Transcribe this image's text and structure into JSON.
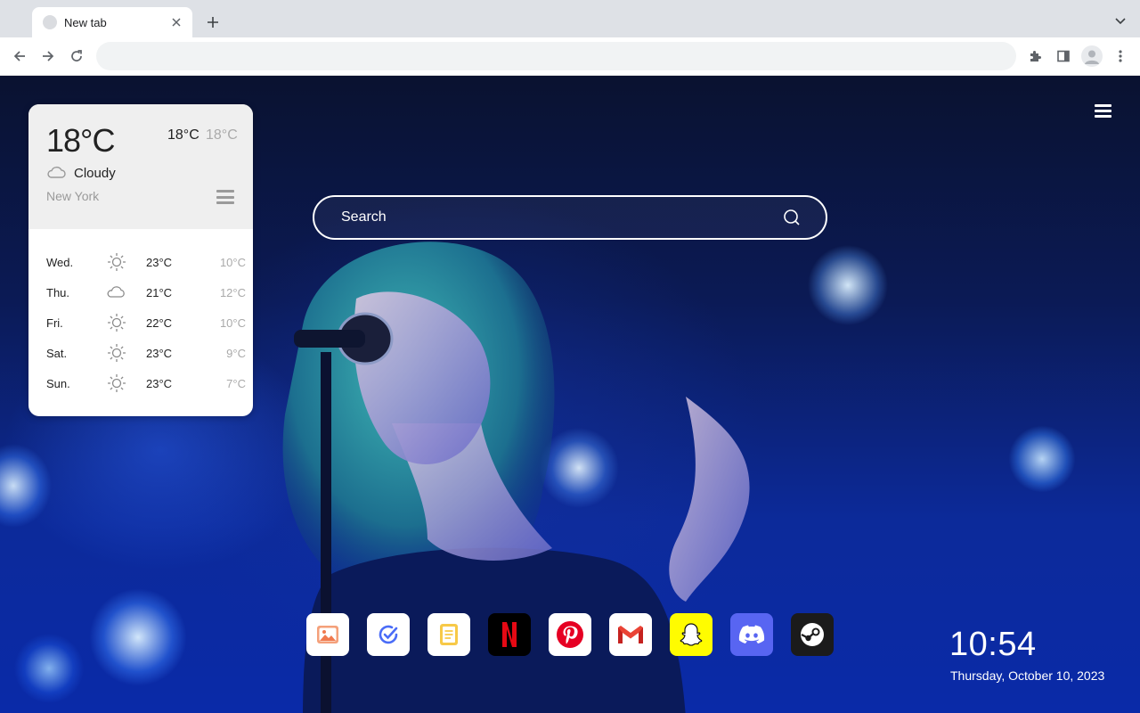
{
  "browser": {
    "tab_title": "New tab",
    "address_value": "",
    "address_placeholder": ""
  },
  "weather": {
    "current_temp": "18°C",
    "high": "18°C",
    "low": "18°C",
    "condition": "Cloudy",
    "condition_icon": "cloud-icon",
    "city": "New York",
    "forecast": [
      {
        "day": "Wed.",
        "icon": "sun-icon",
        "high": "23°C",
        "low": "10°C"
      },
      {
        "day": "Thu.",
        "icon": "cloud-icon",
        "high": "21°C",
        "low": "12°C"
      },
      {
        "day": "Fri.",
        "icon": "sun-icon",
        "high": "22°C",
        "low": "10°C"
      },
      {
        "day": "Sat.",
        "icon": "sun-icon",
        "high": "23°C",
        "low": "9°C"
      },
      {
        "day": "Sun.",
        "icon": "sun-icon",
        "high": "23°C",
        "low": "7°C"
      }
    ]
  },
  "search": {
    "placeholder": "Search"
  },
  "dock": [
    {
      "name": "photos",
      "icon": "photos-icon",
      "bg": "#ffffff"
    },
    {
      "name": "tasks",
      "icon": "check-circle-icon",
      "bg": "#ffffff"
    },
    {
      "name": "notes",
      "icon": "notes-icon",
      "bg": "#ffffff"
    },
    {
      "name": "netflix",
      "icon": "netflix-icon",
      "bg": "#000000"
    },
    {
      "name": "pinterest",
      "icon": "pinterest-icon",
      "bg": "#ffffff"
    },
    {
      "name": "gmail",
      "icon": "gmail-icon",
      "bg": "#ffffff"
    },
    {
      "name": "snapchat",
      "icon": "snapchat-icon",
      "bg": "#fffc00"
    },
    {
      "name": "discord",
      "icon": "discord-icon",
      "bg": "#5865f2"
    },
    {
      "name": "steam",
      "icon": "steam-icon",
      "bg": "#1b1b1b"
    }
  ],
  "clock": {
    "time": "10:54",
    "date": "Thursday, October 10, 2023"
  },
  "colors": {
    "weather_top_bg": "#efefef",
    "page_bg": "#0b1a55"
  }
}
